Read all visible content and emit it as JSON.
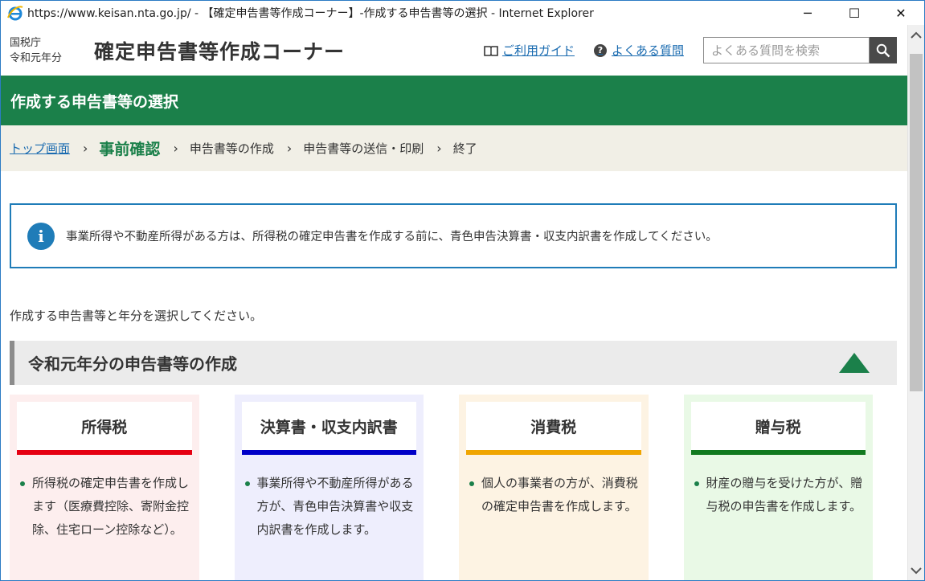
{
  "window": {
    "title": "https://www.keisan.nta.go.jp/ - 【確定申告書等作成コーナー】-作成する申告書等の選択 - Internet Explorer",
    "minimize": "─",
    "maximize": "☐",
    "close": "✕"
  },
  "header": {
    "agency_line1": "国税庁",
    "agency_line2": "令和元年分",
    "corner_title": "確定申告書等作成コーナー",
    "guide_link": "ご利用ガイド",
    "faq_link": "よくある質問",
    "faq_icon_glyph": "?",
    "search_placeholder": "よくある質問を検索"
  },
  "page_title": "作成する申告書等の選択",
  "breadcrumb": {
    "top": "トップ画面",
    "current": "事前確認",
    "step3": "申告書等の作成",
    "step4": "申告書等の送信・印刷",
    "step5": "終了",
    "separator": "›"
  },
  "info": {
    "icon_glyph": "i",
    "text": "事業所得や不動産所得がある方は、所得税の確定申告書を作成する前に、青色申告決算書・収支内訳書を作成してください。"
  },
  "instruction": "作成する申告書等と年分を選択してください。",
  "section": {
    "title": "令和元年分の申告書等の作成"
  },
  "cards": [
    {
      "title": "所得税",
      "bg": "#fdeeee",
      "accent": "#e60012",
      "text": "所得税の確定申告書を作成します（医療費控除、寄附金控除、住宅ローン控除など）。"
    },
    {
      "title": "決算書・収支内訳書",
      "bg": "#eeeefd",
      "accent": "#0000c8",
      "text": "事業所得や不動産所得がある方が、青色申告決算書や収支内訳書を作成します。"
    },
    {
      "title": "消費税",
      "bg": "#fdf3e3",
      "accent": "#f0a500",
      "text": "個人の事業者の方が、消費税の確定申告書を作成します。"
    },
    {
      "title": "贈与税",
      "bg": "#e9f9e6",
      "accent": "#117a1f",
      "text": "財産の贈与を受けた方が、贈与税の申告書を作成します。"
    }
  ],
  "colors": {
    "brand_green": "#1b804a",
    "link_blue": "#1a6bb0",
    "info_blue": "#1f7cb8",
    "breadcrumb_bg": "#f1efe6"
  }
}
